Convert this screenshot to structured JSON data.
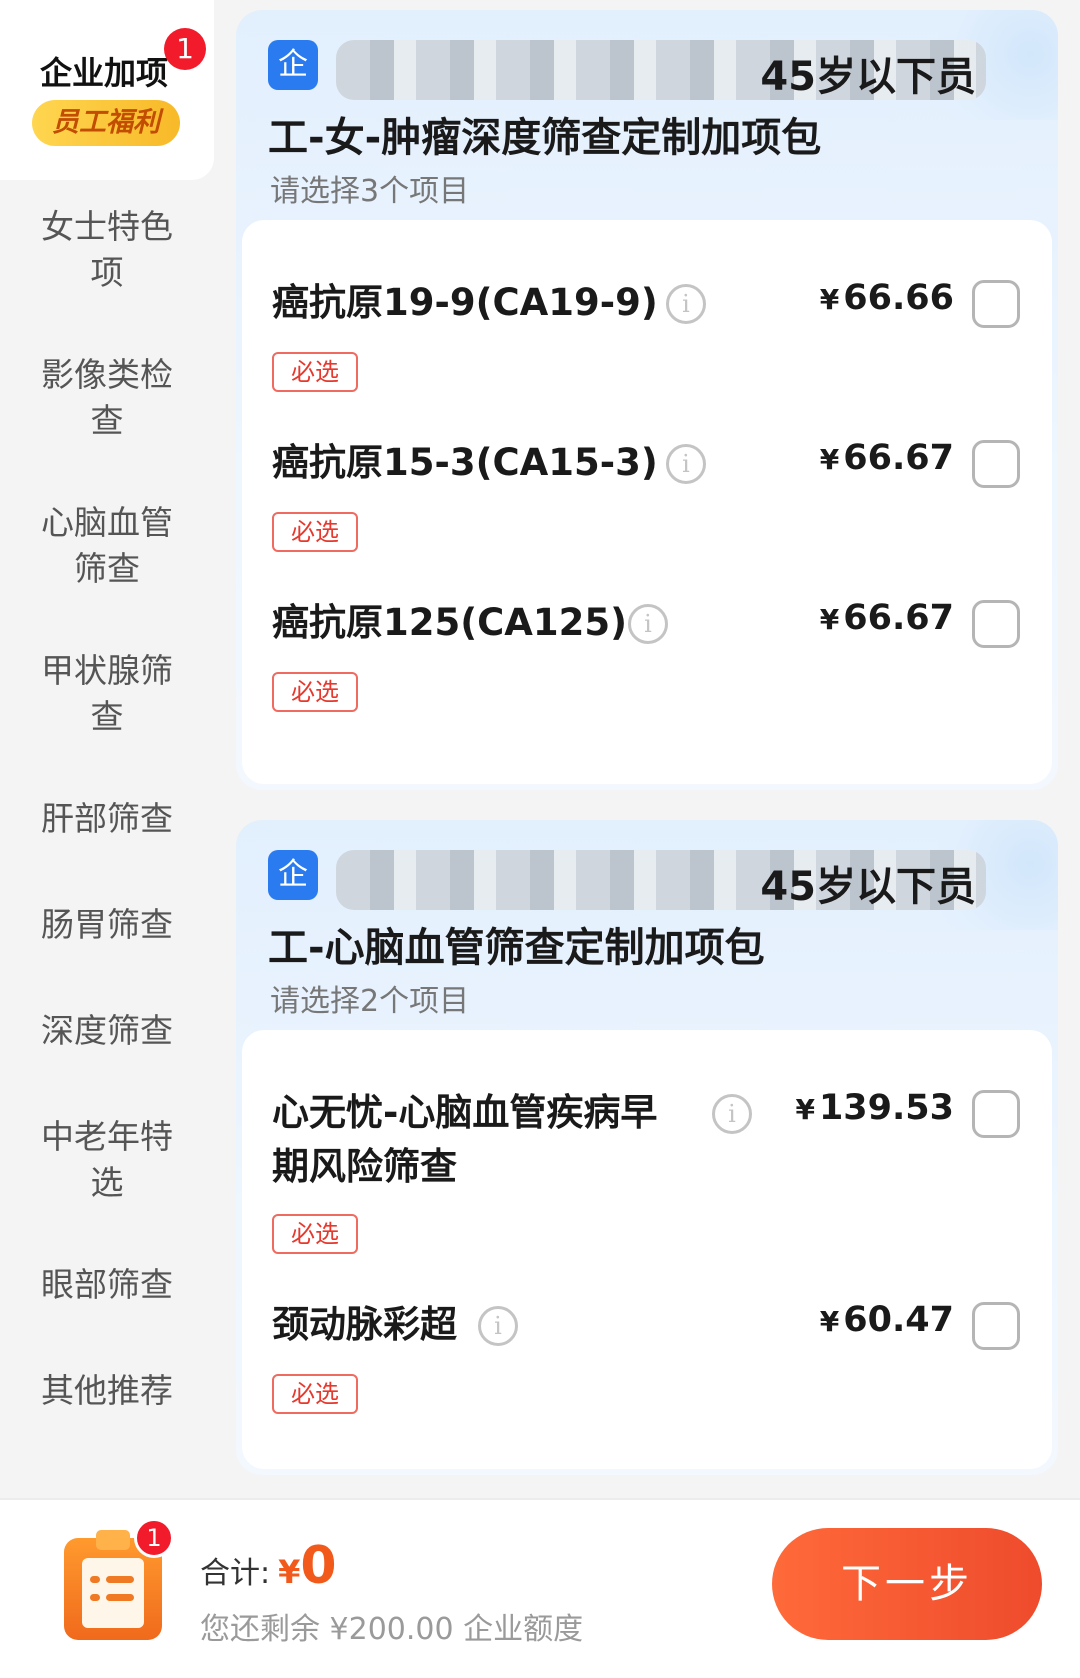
{
  "sidebar": {
    "active": {
      "label": "企业加项",
      "badge": "1",
      "tag": "员工福利"
    },
    "items": [
      {
        "line1": "女士特色",
        "line2": "项"
      },
      {
        "line1": "影像类检",
        "line2": "查"
      },
      {
        "line1": "心脑血管",
        "line2": "筛查"
      },
      {
        "line1": "甲状腺筛",
        "line2": "查"
      },
      {
        "line1": "肝部筛查",
        "line2": ""
      },
      {
        "line1": "肠胃筛查",
        "line2": ""
      },
      {
        "line1": "深度筛查",
        "line2": ""
      },
      {
        "line1": "中老年特",
        "line2": "选"
      },
      {
        "line1": "眼部筛查",
        "line2": ""
      },
      {
        "line1": "其他推荐",
        "line2": ""
      }
    ]
  },
  "packages": [
    {
      "badge": "企",
      "name_line1_tail": "45岁以下员",
      "name_line2": "工-女-肿瘤深度筛查定制加项包",
      "hint": "请选择3个项目",
      "items": [
        {
          "name": "癌抗原19-9(CA19-9)",
          "currency": "¥",
          "price": "66.66",
          "tag": "必选",
          "info": "i"
        },
        {
          "name": "癌抗原15-3(CA15-3)",
          "currency": "¥",
          "price": "66.67",
          "tag": "必选",
          "info": "i"
        },
        {
          "name": "癌抗原125(CA125)",
          "currency": "¥",
          "price": "66.67",
          "tag": "必选",
          "info": "i"
        }
      ]
    },
    {
      "badge": "企",
      "name_line1_tail": "45岁以下员",
      "name_line2": "工-心脑血管筛查定制加项包",
      "hint": "请选择2个项目",
      "items": [
        {
          "name_line1": "心无忧-心脑血管疾病早",
          "name_line2": "期风险筛查",
          "currency": "¥",
          "price": "139.53",
          "tag": "必选",
          "info": "i"
        },
        {
          "name": "颈动脉彩超",
          "currency": "¥",
          "price": "60.47",
          "tag": "必选",
          "info": "i"
        }
      ]
    }
  ],
  "bottom": {
    "cart_badge": "1",
    "total_label": "合计:",
    "currency": "¥",
    "total_amount": "0",
    "remain_text": "您还剩余 ¥200.00 企业额度",
    "next_label": "下一步"
  },
  "colors": {
    "accent": "#ee4b2c",
    "badge": "#f21b2b",
    "enterprise_blue": "#2b7bf0",
    "must_red": "#e6382c"
  }
}
